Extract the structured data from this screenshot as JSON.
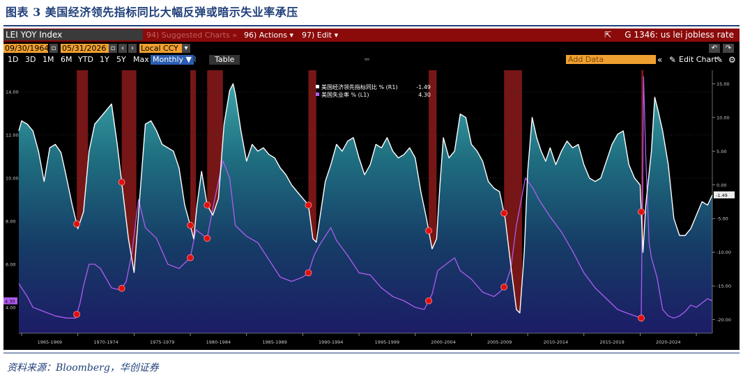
{
  "figure_title": "图表 3 美国经济领先指标同比大幅反弹或暗示失业率承压",
  "source_note": "资料来源：Bloomberg，华创证券",
  "terminal": {
    "index_name": "LEI YOY Index",
    "menu_suggested": "94) Suggested Charts »",
    "menu_actions": "96) Actions ▾",
    "menu_edit": "97) Edit ▾",
    "chart_code": "G 1346: us lei jobless rate",
    "start_date": "09/30/1964",
    "end_date": "05/31/2026",
    "currency": "Local CCY",
    "periods": [
      "1D",
      "3D",
      "1M",
      "6M",
      "YTD",
      "1Y",
      "5Y",
      "Max"
    ],
    "frequency": "Monthly ▼",
    "table_label": "Table",
    "add_data_placeholder": "Add Data",
    "edit_chart_label": "Edit Chart",
    "colors": {
      "lei": "#ffffff",
      "unemp": "#b05cf0",
      "recession": "#8b1a1a",
      "flag": "#e01010"
    }
  },
  "chart_data": {
    "type": "line",
    "legend": {
      "position": "top-center",
      "entries": [
        {
          "label": "美国经济领先指标同比 % (R1)",
          "value": "-1.49"
        },
        {
          "label": "美国失业率 % (L1)",
          "value": "4.30"
        }
      ]
    },
    "left_axis": {
      "ticks": [
        "14.00",
        "12.00",
        "10.00",
        "8.00",
        "6.00",
        "4.00"
      ],
      "range": [
        2.8,
        15.0
      ],
      "current_label": "4.30"
    },
    "right_axis": {
      "ticks": [
        "15.00",
        "10.00",
        "5.00",
        "0.00",
        "-5.00",
        "-10.00",
        "-15.00",
        "-20.00"
      ],
      "range": [
        -22,
        17
      ],
      "current_label": "-1.49"
    },
    "x_axis": {
      "ticks": [
        "1965-1969",
        "1970-1974",
        "1975-1979",
        "1980-1984",
        "1985-1989",
        "1990-1994",
        "1995-1999",
        "2000-2004",
        "2005-2009",
        "2010-2014",
        "2015-2019",
        "2020-2024"
      ],
      "range": [
        1964.75,
        2026.42
      ]
    },
    "recessions": [
      [
        1969.9,
        1970.9
      ],
      [
        1973.9,
        1975.2
      ],
      [
        1980.0,
        1980.5
      ],
      [
        1981.5,
        1982.9
      ],
      [
        1990.5,
        1991.2
      ],
      [
        2001.2,
        2001.9
      ],
      [
        2007.9,
        2009.5
      ],
      [
        2020.1,
        2020.3
      ]
    ],
    "series": [
      {
        "name": "美国经济领先指标同比 % (R1)",
        "axis": "right",
        "points": [
          [
            1964.75,
            8.0
          ],
          [
            1965.0,
            9.5
          ],
          [
            1965.5,
            9.0
          ],
          [
            1966.0,
            8.0
          ],
          [
            1966.5,
            5.0
          ],
          [
            1967.0,
            0.5
          ],
          [
            1967.5,
            5.5
          ],
          [
            1968.0,
            6.0
          ],
          [
            1968.5,
            4.8
          ],
          [
            1969.0,
            1.0
          ],
          [
            1969.5,
            -3.0
          ],
          [
            1970.0,
            -6.5
          ],
          [
            1970.5,
            -4.0
          ],
          [
            1971.0,
            5.0
          ],
          [
            1971.5,
            9.0
          ],
          [
            1972.0,
            10.0
          ],
          [
            1972.5,
            11.0
          ],
          [
            1973.0,
            12.0
          ],
          [
            1973.5,
            6.0
          ],
          [
            1974.0,
            -1.0
          ],
          [
            1974.5,
            -8.0
          ],
          [
            1975.0,
            -13.0
          ],
          [
            1975.5,
            -2.0
          ],
          [
            1976.0,
            9.0
          ],
          [
            1976.5,
            9.5
          ],
          [
            1977.0,
            8.0
          ],
          [
            1977.5,
            6.0
          ],
          [
            1978.0,
            5.5
          ],
          [
            1978.5,
            5.0
          ],
          [
            1979.0,
            2.5
          ],
          [
            1979.5,
            -3.0
          ],
          [
            1980.0,
            -6.0
          ],
          [
            1980.3,
            -8.0
          ],
          [
            1980.6,
            -3.0
          ],
          [
            1981.0,
            2.0
          ],
          [
            1981.5,
            -3.0
          ],
          [
            1982.0,
            -4.5
          ],
          [
            1982.5,
            -2.0
          ],
          [
            1983.0,
            9.0
          ],
          [
            1983.5,
            14.0
          ],
          [
            1983.8,
            15.0
          ],
          [
            1984.0,
            13.5
          ],
          [
            1984.5,
            8.0
          ],
          [
            1985.0,
            3.5
          ],
          [
            1985.5,
            6.0
          ],
          [
            1986.0,
            5.0
          ],
          [
            1986.5,
            5.5
          ],
          [
            1987.0,
            4.5
          ],
          [
            1987.5,
            4.0
          ],
          [
            1988.0,
            2.5
          ],
          [
            1988.5,
            1.5
          ],
          [
            1989.0,
            0.0
          ],
          [
            1989.5,
            -1.0
          ],
          [
            1990.0,
            -2.0
          ],
          [
            1990.5,
            -3.0
          ],
          [
            1990.9,
            -8.0
          ],
          [
            1991.2,
            -8.5
          ],
          [
            1991.6,
            -4.0
          ],
          [
            1992.0,
            0.5
          ],
          [
            1992.5,
            3.0
          ],
          [
            1993.0,
            6.0
          ],
          [
            1993.5,
            5.0
          ],
          [
            1994.0,
            6.5
          ],
          [
            1994.5,
            7.0
          ],
          [
            1995.0,
            4.0
          ],
          [
            1995.5,
            1.5
          ],
          [
            1996.0,
            3.0
          ],
          [
            1996.5,
            6.0
          ],
          [
            1997.0,
            5.5
          ],
          [
            1997.5,
            7.0
          ],
          [
            1998.0,
            5.0
          ],
          [
            1998.5,
            4.0
          ],
          [
            1999.0,
            4.5
          ],
          [
            1999.5,
            5.5
          ],
          [
            2000.0,
            4.0
          ],
          [
            2000.5,
            -1.0
          ],
          [
            2001.0,
            -5.0
          ],
          [
            2001.5,
            -9.5
          ],
          [
            2001.9,
            -8.0
          ],
          [
            2002.2,
            0.0
          ],
          [
            2002.5,
            7.0
          ],
          [
            2003.0,
            4.0
          ],
          [
            2003.5,
            5.0
          ],
          [
            2004.0,
            10.5
          ],
          [
            2004.5,
            10.0
          ],
          [
            2005.0,
            6.0
          ],
          [
            2005.5,
            5.0
          ],
          [
            2006.0,
            3.5
          ],
          [
            2006.5,
            0.5
          ],
          [
            2007.0,
            -0.5
          ],
          [
            2007.5,
            -1.0
          ],
          [
            2008.0,
            -5.0
          ],
          [
            2008.5,
            -12.0
          ],
          [
            2009.0,
            -18.5
          ],
          [
            2009.3,
            -19.0
          ],
          [
            2009.7,
            -10.0
          ],
          [
            2010.0,
            2.0
          ],
          [
            2010.4,
            10.0
          ],
          [
            2010.8,
            7.0
          ],
          [
            2011.2,
            5.0
          ],
          [
            2011.6,
            3.5
          ],
          [
            2012.0,
            5.5
          ],
          [
            2012.5,
            3.0
          ],
          [
            2013.0,
            5.0
          ],
          [
            2013.5,
            6.5
          ],
          [
            2014.0,
            5.5
          ],
          [
            2014.5,
            6.0
          ],
          [
            2015.0,
            3.0
          ],
          [
            2015.5,
            1.0
          ],
          [
            2016.0,
            0.5
          ],
          [
            2016.5,
            1.0
          ],
          [
            2017.0,
            3.5
          ],
          [
            2017.5,
            6.0
          ],
          [
            2018.0,
            7.5
          ],
          [
            2018.5,
            8.0
          ],
          [
            2019.0,
            3.0
          ],
          [
            2019.5,
            1.0
          ],
          [
            2020.0,
            0.0
          ],
          [
            2020.25,
            -10.0
          ],
          [
            2020.5,
            -3.0
          ],
          [
            2021.0,
            5.0
          ],
          [
            2021.3,
            13.0
          ],
          [
            2021.6,
            11.0
          ],
          [
            2022.0,
            8.0
          ],
          [
            2022.5,
            3.0
          ],
          [
            2023.0,
            -5.0
          ],
          [
            2023.5,
            -7.5
          ],
          [
            2024.0,
            -7.5
          ],
          [
            2024.5,
            -6.5
          ],
          [
            2025.0,
            -4.5
          ],
          [
            2025.5,
            -2.5
          ],
          [
            2026.0,
            -3.0
          ],
          [
            2026.42,
            -1.49
          ]
        ]
      },
      {
        "name": "美国失业率 % (L1)",
        "axis": "left",
        "points": [
          [
            1964.75,
            5.1
          ],
          [
            1965.0,
            4.9
          ],
          [
            1965.5,
            4.5
          ],
          [
            1966.0,
            4.0
          ],
          [
            1967.0,
            3.8
          ],
          [
            1968.0,
            3.6
          ],
          [
            1969.0,
            3.5
          ],
          [
            1969.8,
            3.5
          ],
          [
            1970.2,
            4.2
          ],
          [
            1970.5,
            5.0
          ],
          [
            1971.0,
            6.0
          ],
          [
            1971.5,
            6.0
          ],
          [
            1972.0,
            5.8
          ],
          [
            1973.0,
            4.9
          ],
          [
            1973.8,
            4.8
          ],
          [
            1974.3,
            5.2
          ],
          [
            1974.8,
            6.5
          ],
          [
            1975.4,
            9.0
          ],
          [
            1976.0,
            7.7
          ],
          [
            1977.0,
            7.2
          ],
          [
            1978.0,
            6.0
          ],
          [
            1979.0,
            5.8
          ],
          [
            1980.0,
            6.3
          ],
          [
            1980.5,
            7.6
          ],
          [
            1981.0,
            7.4
          ],
          [
            1981.5,
            7.2
          ],
          [
            1982.0,
            8.6
          ],
          [
            1982.9,
            10.8
          ],
          [
            1983.5,
            10.0
          ],
          [
            1984.0,
            7.8
          ],
          [
            1985.0,
            7.3
          ],
          [
            1986.0,
            7.0
          ],
          [
            1987.0,
            6.2
          ],
          [
            1988.0,
            5.4
          ],
          [
            1989.0,
            5.2
          ],
          [
            1990.0,
            5.4
          ],
          [
            1990.5,
            5.6
          ],
          [
            1991.0,
            6.4
          ],
          [
            1991.5,
            6.9
          ],
          [
            1992.5,
            7.7
          ],
          [
            1993.0,
            7.1
          ],
          [
            1994.0,
            6.4
          ],
          [
            1995.0,
            5.6
          ],
          [
            1996.0,
            5.5
          ],
          [
            1997.0,
            4.9
          ],
          [
            1998.0,
            4.5
          ],
          [
            1999.0,
            4.3
          ],
          [
            2000.0,
            4.0
          ],
          [
            2000.8,
            3.9
          ],
          [
            2001.5,
            4.6
          ],
          [
            2002.0,
            5.7
          ],
          [
            2003.5,
            6.3
          ],
          [
            2004.0,
            5.7
          ],
          [
            2005.0,
            5.3
          ],
          [
            2006.0,
            4.7
          ],
          [
            2007.0,
            4.5
          ],
          [
            2007.5,
            4.7
          ],
          [
            2008.0,
            5.0
          ],
          [
            2008.5,
            5.8
          ],
          [
            2009.0,
            7.8
          ],
          [
            2009.8,
            10.0
          ],
          [
            2010.5,
            9.5
          ],
          [
            2011.0,
            9.0
          ],
          [
            2012.0,
            8.2
          ],
          [
            2013.0,
            7.5
          ],
          [
            2014.0,
            6.6
          ],
          [
            2015.0,
            5.6
          ],
          [
            2016.0,
            4.9
          ],
          [
            2017.0,
            4.4
          ],
          [
            2018.0,
            3.9
          ],
          [
            2019.0,
            3.7
          ],
          [
            2020.1,
            3.5
          ],
          [
            2020.3,
            14.7
          ],
          [
            2020.5,
            11.0
          ],
          [
            2020.8,
            7.0
          ],
          [
            2021.0,
            6.3
          ],
          [
            2021.5,
            5.4
          ],
          [
            2022.0,
            3.9
          ],
          [
            2022.5,
            3.6
          ],
          [
            2023.0,
            3.5
          ],
          [
            2023.5,
            3.6
          ],
          [
            2024.0,
            3.8
          ],
          [
            2024.5,
            4.1
          ],
          [
            2025.0,
            4.0
          ],
          [
            2025.5,
            4.2
          ],
          [
            2026.0,
            4.4
          ],
          [
            2026.42,
            4.3
          ]
        ]
      }
    ]
  }
}
